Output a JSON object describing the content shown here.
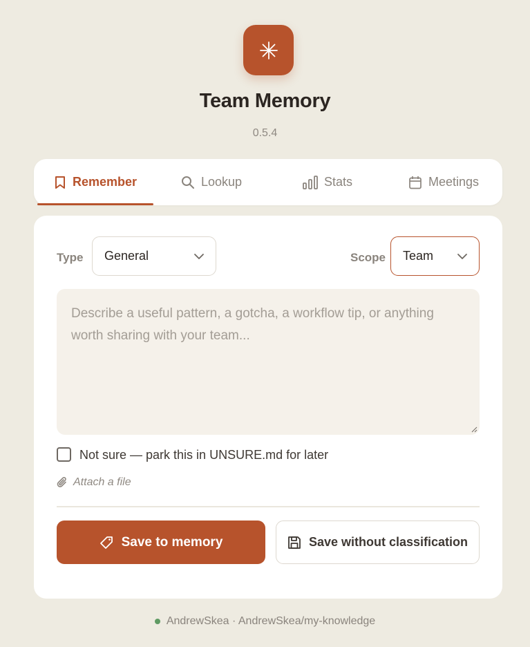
{
  "app": {
    "name": "Team Memory",
    "version": "0.5.4",
    "icon": "asterisk-icon",
    "accent_color": "#b7532c"
  },
  "tabs": [
    {
      "label": "Remember",
      "icon": "bookmark-icon",
      "active": true
    },
    {
      "label": "Lookup",
      "icon": "search-icon",
      "active": false
    },
    {
      "label": "Stats",
      "icon": "bar-chart-icon",
      "active": false
    },
    {
      "label": "Meetings",
      "icon": "calendar-icon",
      "active": false
    }
  ],
  "form": {
    "type_label": "Type",
    "type_value": "General",
    "scope_label": "Scope",
    "scope_value": "Team",
    "note_placeholder": "Describe a useful pattern, a gotcha, a workflow tip, or anything worth sharing with your team...",
    "note_value": "",
    "unsure_label": "Not sure — park this in UNSURE.md for later",
    "unsure_checked": false,
    "attach_label": "Attach a file"
  },
  "actions": {
    "save_label": "Save to memory",
    "save_raw_label": "Save without classification"
  },
  "footer": {
    "status_color": "#5f9a63",
    "text": "AndrewSkea · AndrewSkea/my-knowledge"
  }
}
